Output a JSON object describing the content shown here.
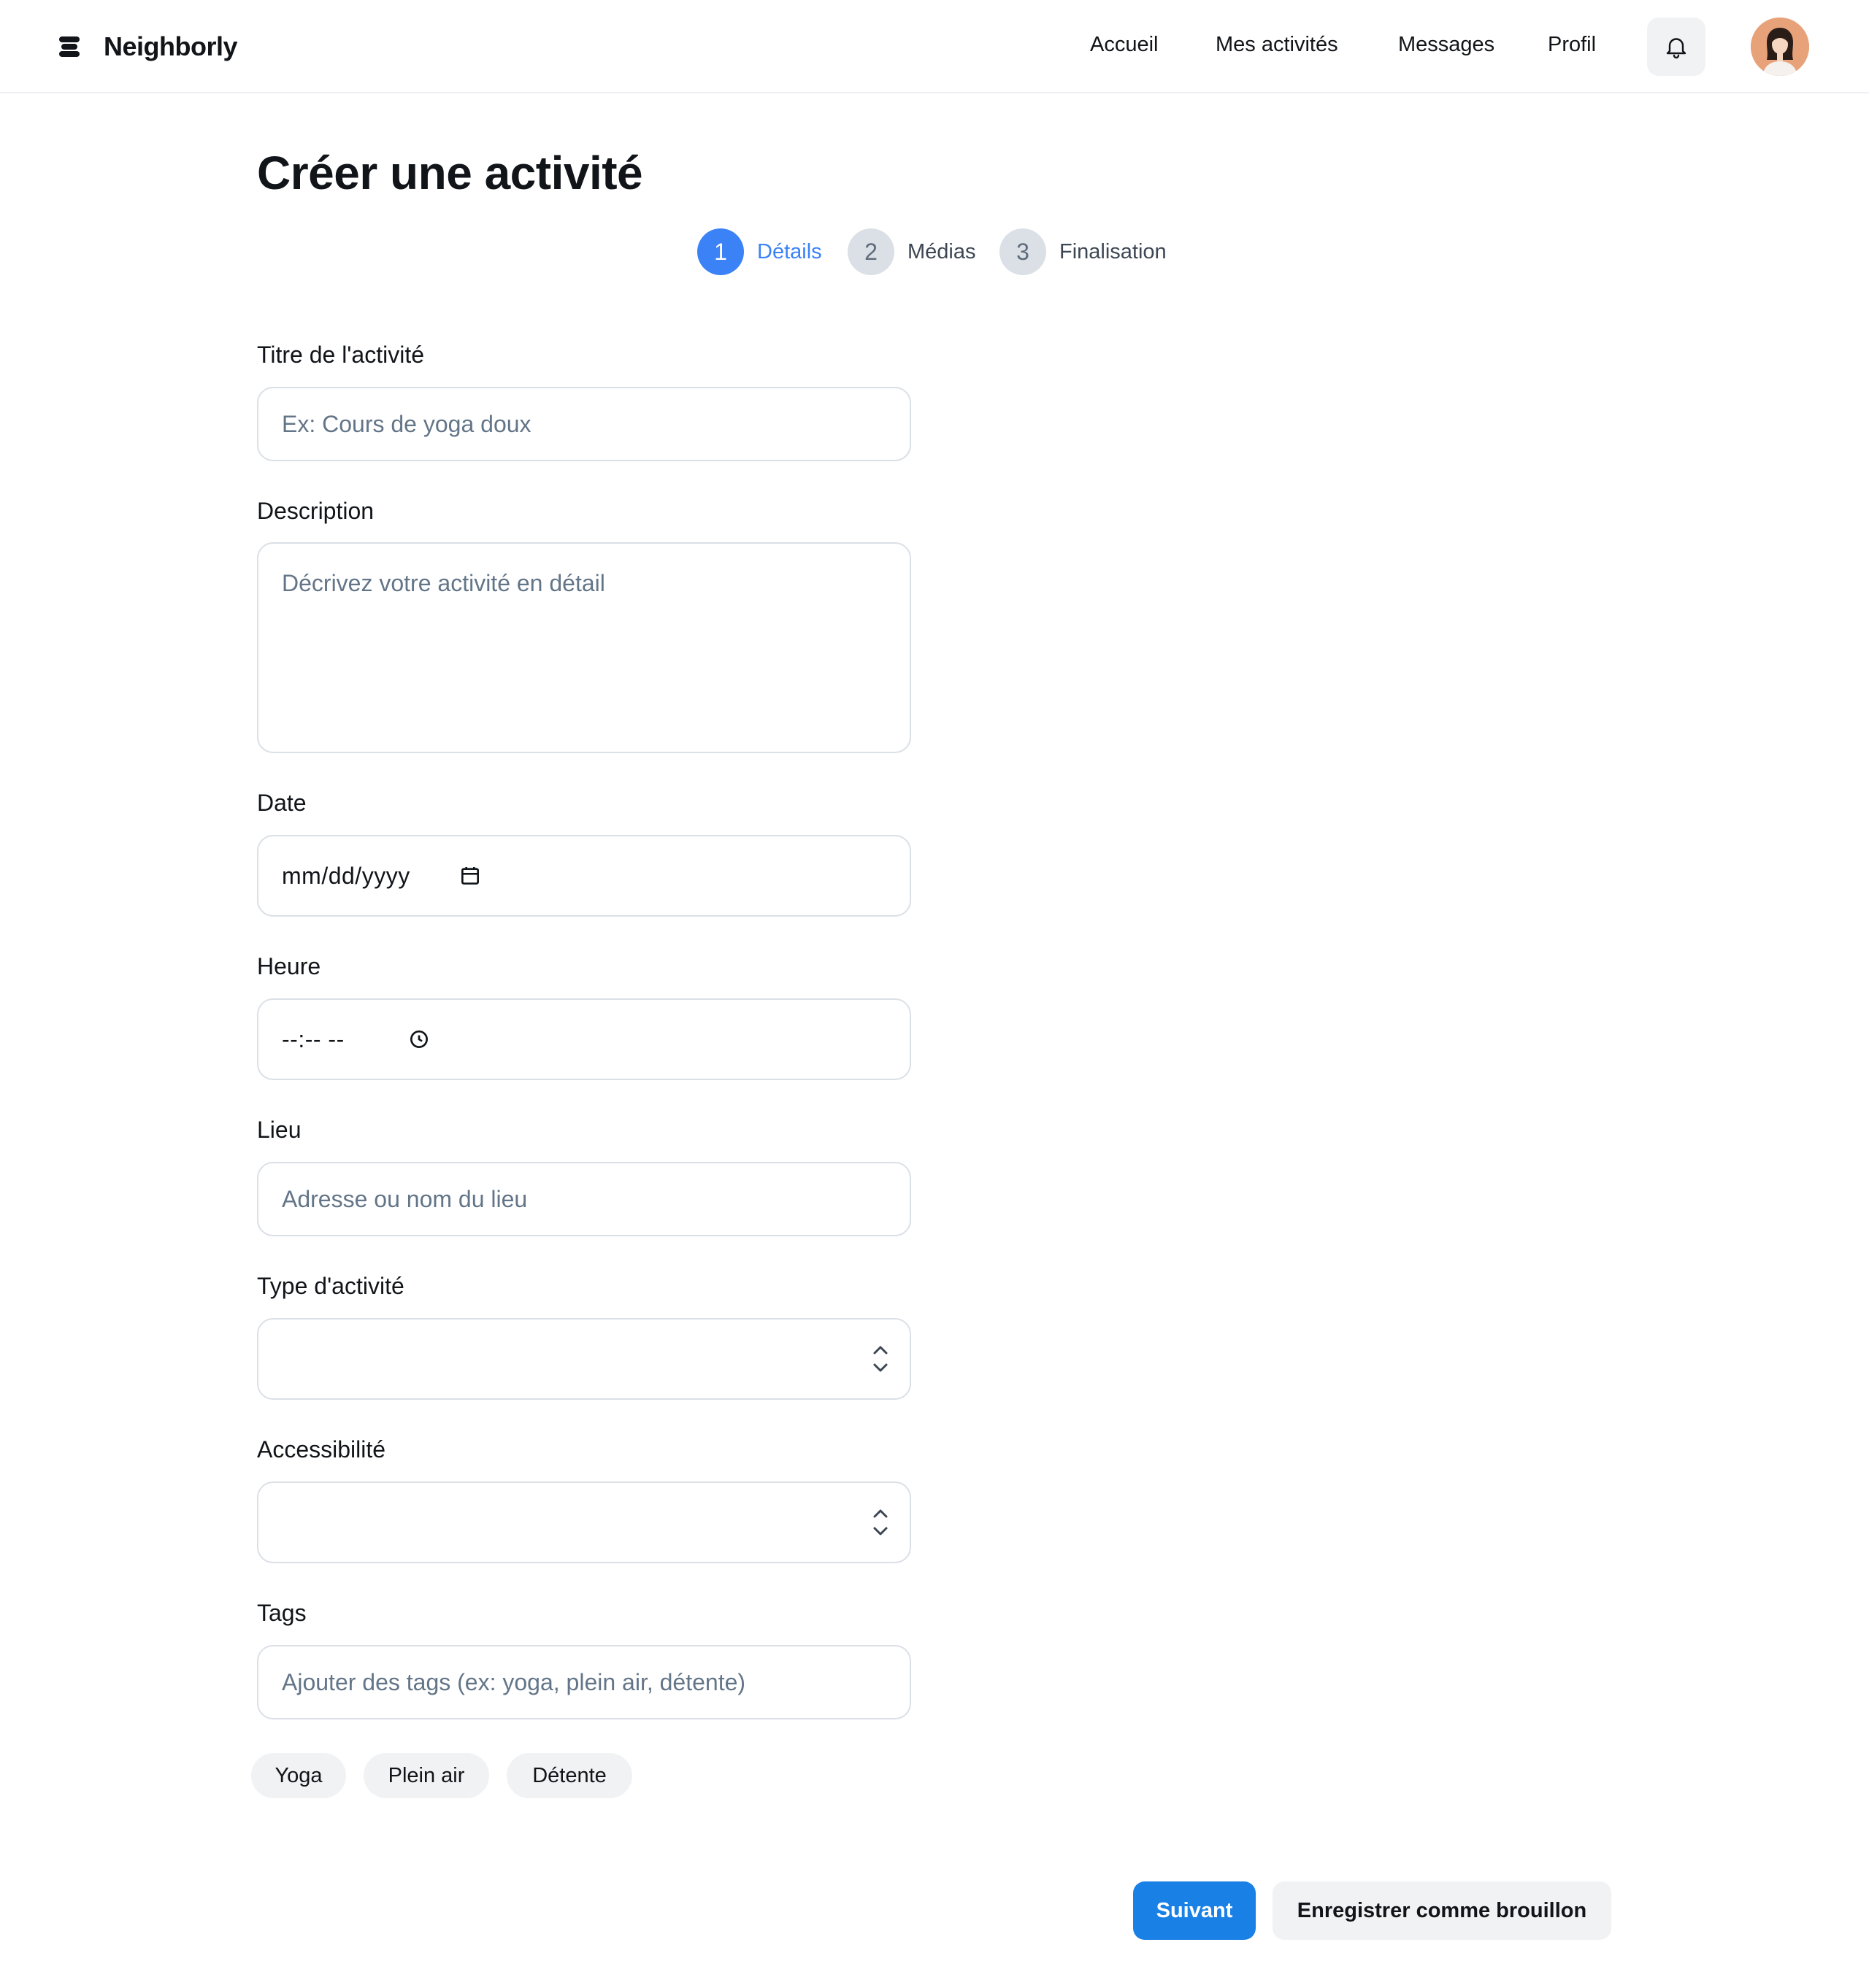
{
  "app": {
    "name": "Neighborly"
  },
  "nav": {
    "items": [
      "Accueil",
      "Mes activités",
      "Messages",
      "Profil"
    ]
  },
  "page": {
    "title": "Créer une activité"
  },
  "stepper": {
    "steps": [
      {
        "number": "1",
        "label": "Détails",
        "state": "active"
      },
      {
        "number": "2",
        "label": "Médias",
        "state": "inactive"
      },
      {
        "number": "3",
        "label": "Finalisation",
        "state": "inactive"
      }
    ]
  },
  "form": {
    "title": {
      "label": "Titre de l'activité",
      "placeholder": "Ex: Cours de yoga doux"
    },
    "description": {
      "label": "Description",
      "placeholder": "Décrivez votre activité en détail"
    },
    "date": {
      "label": "Date",
      "display": "mm/dd/yyyy"
    },
    "time": {
      "label": "Heure",
      "display": "--:-- --"
    },
    "location": {
      "label": "Lieu",
      "placeholder": "Adresse ou nom du lieu"
    },
    "type": {
      "label": "Type d'activité",
      "value": ""
    },
    "accessibility": {
      "label": "Accessibilité",
      "value": ""
    },
    "tags": {
      "label": "Tags",
      "placeholder": "Ajouter des tags (ex: yoga, plein air, détente)"
    }
  },
  "tags": [
    "Yoga",
    "Plein air",
    "Détente"
  ],
  "actions": {
    "next": "Suivant",
    "save_draft": "Enregistrer comme brouillon"
  },
  "colors": {
    "primary": "#1980e6",
    "step_active": "#3b82f6",
    "border": "#dbe0e6",
    "muted_bg": "#f0f2f4"
  }
}
